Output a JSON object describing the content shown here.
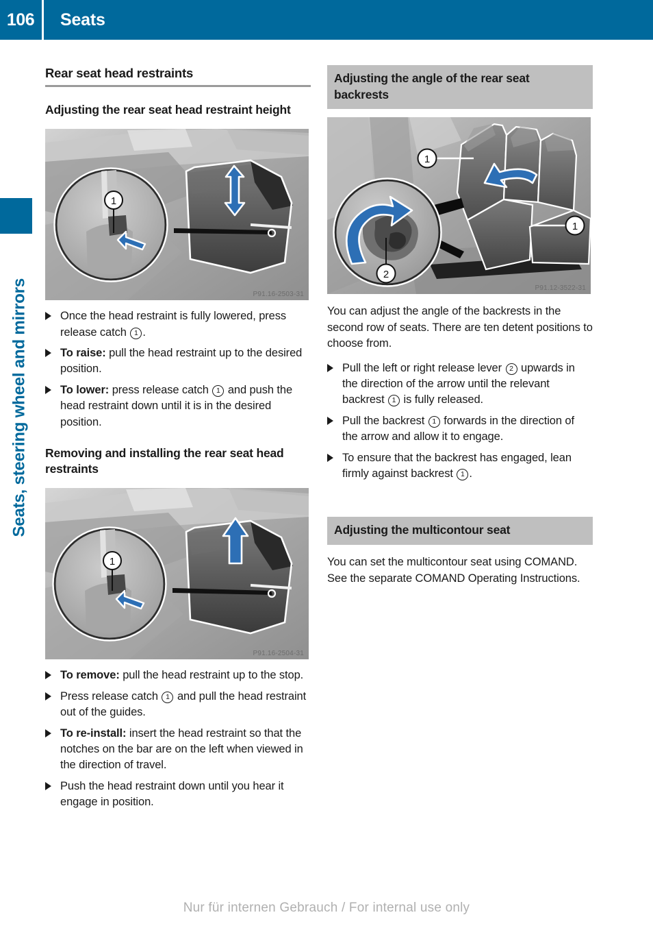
{
  "header": {
    "page_number": "106",
    "title": "Seats",
    "bar_color": "#00699c"
  },
  "chapter_tab": {
    "label": "Seats, steering wheel and mirrors",
    "color": "#00699c"
  },
  "left_column": {
    "section_title": "Rear seat head restraints",
    "subsection_1_title": "Adjusting the rear seat head restraint height",
    "figure_1": {
      "code": "P91.16-2503-31",
      "callouts": [
        "1"
      ],
      "alt": "Rear seat head restraint with magnified detail of release catch"
    },
    "steps_1": [
      {
        "lead": "",
        "text": "Once the head restraint is fully lowered, press release catch ①."
      },
      {
        "lead": "To raise:",
        "text": " pull the head restraint up to the desired position."
      },
      {
        "lead": "To lower:",
        "text": " press release catch ① and push the head restraint down until it is in the desired position."
      }
    ],
    "subsection_2_title": "Removing and installing the rear seat head restraints",
    "figure_2": {
      "code": "P91.16-2504-31",
      "callouts": [
        "1"
      ],
      "alt": "Rear seat head restraint removal with magnified detail of release catch"
    },
    "steps_2": [
      {
        "lead": "To remove:",
        "text": " pull the head restraint up to the stop."
      },
      {
        "lead": "",
        "text": "Press release catch ① and pull the head restraint out of the guides."
      },
      {
        "lead": "To re-install:",
        "text": " insert the head restraint so that the notches on the bar are on the left when viewed in the direction of travel."
      },
      {
        "lead": "",
        "text": "Push the head restraint down until you hear it engage in position."
      }
    ]
  },
  "right_column": {
    "banner_1_title": "Adjusting the angle of the rear seat backrests",
    "figure_3": {
      "code": "P91.12-3522-31",
      "callouts": [
        "1",
        "2"
      ],
      "alt": "Second row of seats with backrests and release lever detail"
    },
    "intro_paragraph": "You can adjust the angle of the backrests in the second row of seats. There are ten detent positions to choose from.",
    "steps_3": [
      {
        "lead": "",
        "text": "Pull the left or right release lever ② upwards in the direction of the arrow until the relevant backrest ① is fully released."
      },
      {
        "lead": "",
        "text": "Pull the backrest ① forwards in the direction of the arrow and allow it to engage."
      },
      {
        "lead": "",
        "text": "To ensure that the backrest has engaged, lean firmly against backrest ①."
      }
    ],
    "banner_2_title": "Adjusting the multicontour seat",
    "body_paragraph": "You can set the multicontour seat using COMAND. See the separate COMAND Operating Instructions."
  },
  "footer": {
    "note": "Nur für internen Gebrauch / For internal use only"
  }
}
